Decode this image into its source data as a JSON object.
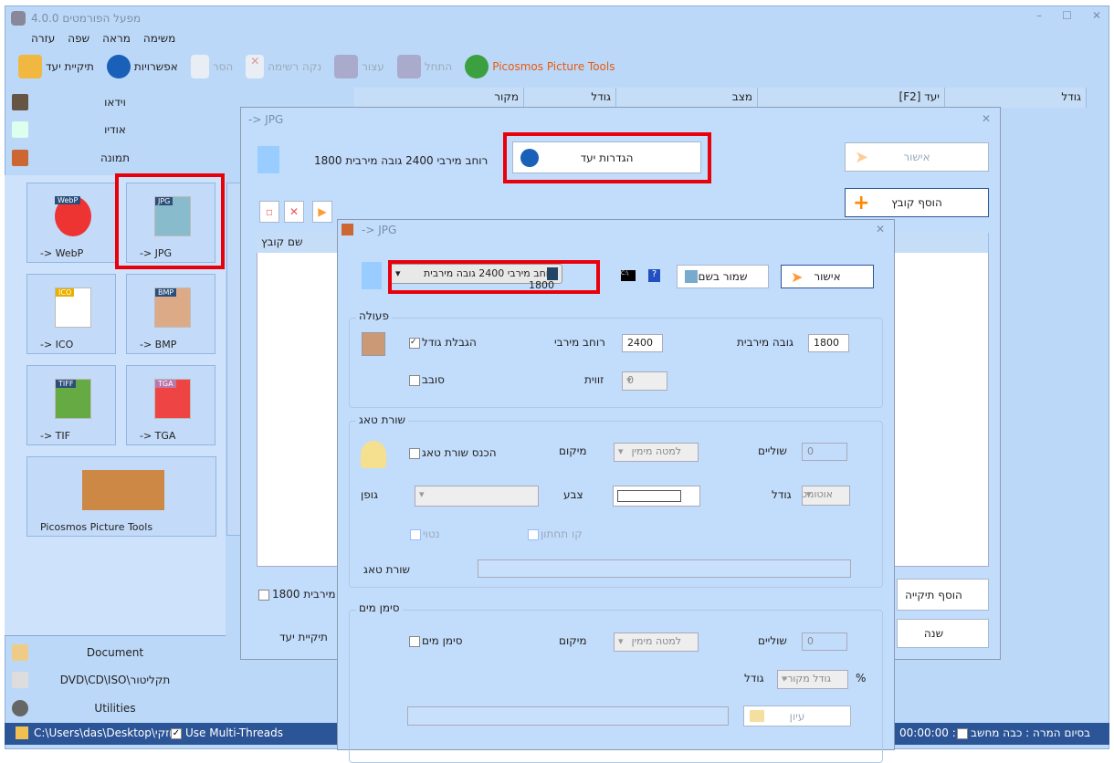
{
  "app": {
    "title": "מפעל הפורמטים 4.0.0"
  },
  "menu": [
    "עזרה",
    "שפה",
    "מראה",
    "משימה"
  ],
  "toolbar": {
    "target_folder": "תיקיית יעד",
    "options": "אפשרויות",
    "remove": "הסר",
    "clear_list": "נקה רשימה",
    "stop": "עצור",
    "start": "התחל",
    "picosmos": "Picosmos Picture Tools"
  },
  "categories": {
    "video": "וידאו",
    "audio": "אודיו",
    "image": "תמונה",
    "document": "Document",
    "dvd": "DVD\\CD\\ISO\\תקליטור",
    "utilities": "Utilities"
  },
  "tiles": [
    {
      "label": "-> WebP",
      "badge": "WebP"
    },
    {
      "label": "-> JPG",
      "badge": "JPG"
    },
    {
      "label": "-> ICO",
      "badge": "ICO"
    },
    {
      "label": "-> BMP",
      "badge": "BMP"
    },
    {
      "label": "-> TIF",
      "badge": "TIFF"
    },
    {
      "label": "-> TGA",
      "badge": "TGA"
    },
    {
      "label": "Picosmos Picture Tools"
    }
  ],
  "table": {
    "columns": [
      "מקור",
      "גודל",
      "מצב",
      "יעד [F2]",
      "גודל"
    ]
  },
  "status": {
    "path": "C:\\Users\\das\\Desktop\\חזקי",
    "multithread": "Use Multi-Threads",
    "time": "00:00:00 :",
    "shutdown": "בסיום המרה : כבה מחשב"
  },
  "dialog1": {
    "title": "-> JPG",
    "summary": "רוחב מירבי 2400 גובה מירבית 1800",
    "settings": "הגדרות יעד",
    "ok": "אישור",
    "add_file": "הוסף קובץ",
    "add_folder": "הוסף תיקייה",
    "change": "שנה",
    "file_name_col": "שם קובץ",
    "partial_check": "ה מירבית 1800",
    "target_folder": "תיקיית יעד"
  },
  "dialog2": {
    "title": "-> JPG",
    "preset": "רוחב מירבי 2400 גובה מירבית 1800",
    "save_as": "שמור בשם",
    "ok": "אישור",
    "help": "?",
    "action": {
      "legend": "פעולה",
      "limit_size": "הגבלת גודל",
      "max_width_label": "רוחב מירבי",
      "max_width": "2400",
      "max_height_label": "גובה מירבית",
      "max_height": "1800",
      "rotate": "סובב",
      "angle_label": "זווית",
      "angle": "0"
    },
    "tag": {
      "legend": "שורת טאג",
      "insert": "הכנס שורת טאג",
      "position_label": "מיקום",
      "position": "למטה מימין",
      "margins_label": "שוליים",
      "margins": "0",
      "font_label": "גופן",
      "color_label": "צבע",
      "size_label": "גודל",
      "size": "אוטומטי",
      "italic": "נטוי",
      "underline": "קו תחתון",
      "line_label": "שורת טאג"
    },
    "watermark": {
      "legend": "סימן מים",
      "enable": "סימן מים",
      "position_label": "מיקום",
      "position": "למטה מימין",
      "margins_label": "שוליים",
      "margins": "0",
      "size_label": "גודל",
      "size": "גודל מקורי",
      "percent": "%",
      "browse": "עיון"
    }
  },
  "colors": {
    "highlight": "#e8000b",
    "status": "#2c5597"
  }
}
